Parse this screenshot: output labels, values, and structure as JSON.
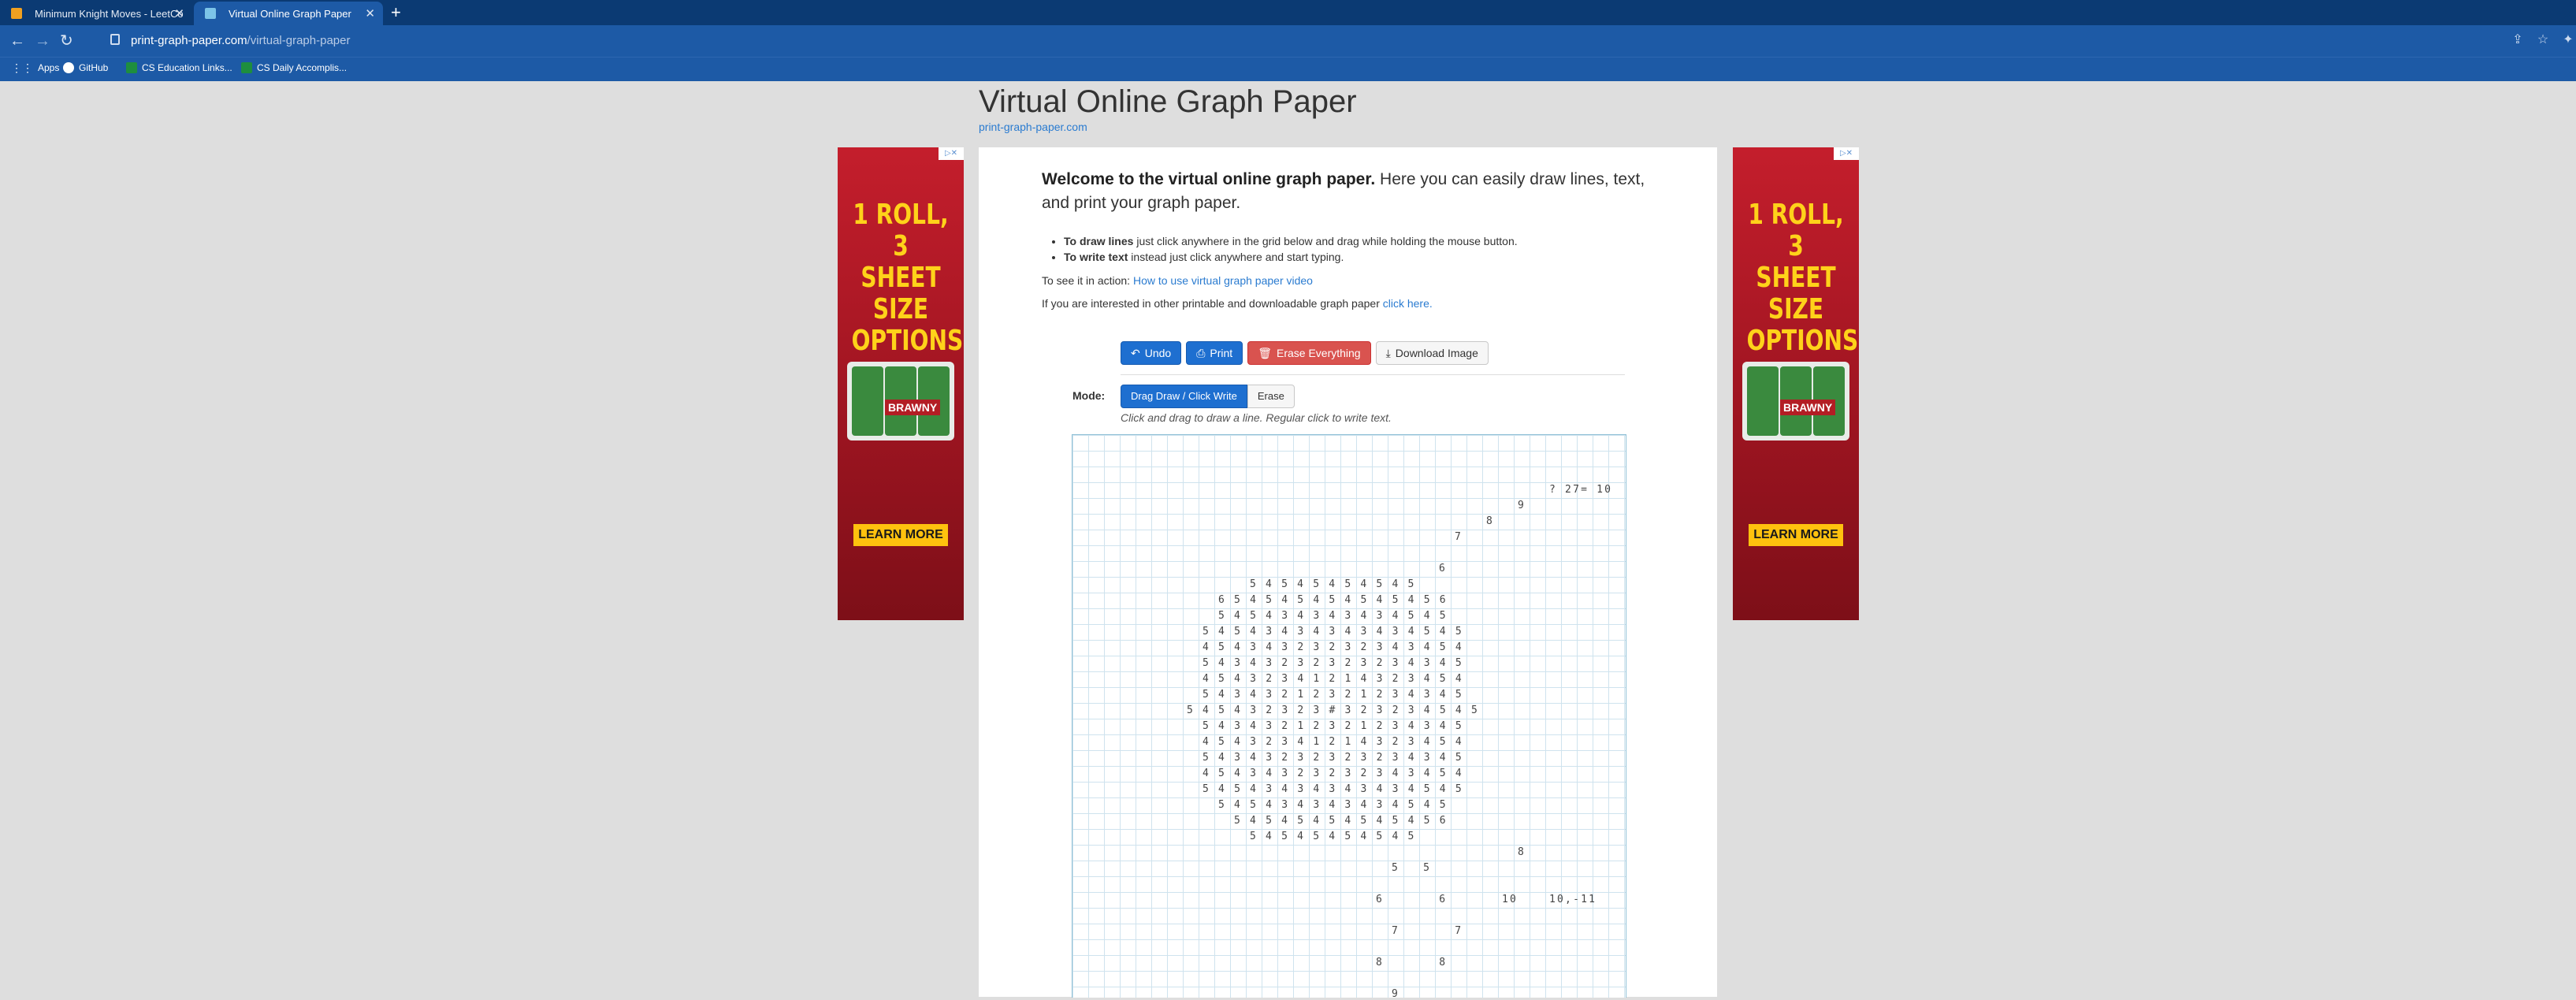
{
  "browser": {
    "tabs": [
      {
        "title": "Minimum Knight Moves - LeetCo",
        "active": false
      },
      {
        "title": "Virtual Online Graph Paper",
        "active": true
      }
    ],
    "url_host": "print-graph-paper.com",
    "url_path": "/virtual-graph-paper",
    "bookmarks": [
      "Apps",
      "GitHub",
      "CS Education Links...",
      "CS Daily Accomplis..."
    ]
  },
  "page": {
    "title": "Virtual Online Graph Paper",
    "subtitle": "print-graph-paper.com",
    "welcome_bold": "Welcome to the virtual online graph paper.",
    "welcome_rest": " Here you can easily draw lines, text, and print your graph paper.",
    "instructions": [
      {
        "bold": "To draw lines",
        "text": " just click anywhere in the grid below and drag while holding the mouse button."
      },
      {
        "bold": "To write text",
        "text": " instead just click anywhere and start typing."
      }
    ],
    "action_prefix": "To see it in action: ",
    "action_link": "How to use virtual graph paper video",
    "interest_prefix": "If you are interested in other printable and downloadable graph paper ",
    "interest_link": "click here."
  },
  "toolbar": {
    "undo": "Undo",
    "print": "Print",
    "erase_everything": "Erase Everything",
    "download_image": "Download Image"
  },
  "mode": {
    "label": "Mode:",
    "drag_draw": "Drag Draw / Click Write",
    "erase": "Erase",
    "hint": "Click and drag to draw a line. Regular click to write text."
  },
  "ads": {
    "headline": [
      "1 ROLL,",
      "3 SHEET",
      "SIZE",
      "OPTIONS"
    ],
    "brand": "BRAWNY",
    "cta": "LEARN MORE"
  },
  "grid_rows": [
    {
      "col": 30,
      "row": 3,
      "text": "? 27= 10"
    },
    {
      "col": 28,
      "row": 4,
      "text": "9"
    },
    {
      "col": 26,
      "row": 5,
      "text": "8"
    },
    {
      "col": 24,
      "row": 6,
      "text": "7"
    },
    {
      "col": 23,
      "row": 8,
      "text": "6"
    },
    {
      "col": 11,
      "row": 9,
      "text": "5 4 5 4 5 4 5 4 5 4 5"
    },
    {
      "col": 9,
      "row": 10,
      "text": "6 5 4 5 4 5 4 5 4 5 4 5 4 5 6"
    },
    {
      "col": 9,
      "row": 11,
      "text": "5 4 5 4 3 4 3 4 3 4 3 4 5 4 5"
    },
    {
      "col": 8,
      "row": 12,
      "text": "5 4 5 4 3 4 3 4 3 4 3 4 3 4 5 4 5"
    },
    {
      "col": 8,
      "row": 13,
      "text": "4 5 4 3 4 3 2 3 2 3 2 3 4 3 4 5 4"
    },
    {
      "col": 8,
      "row": 14,
      "text": "5 4 3 4 3 2 3 2 3 2 3 2 3 4 3 4 5"
    },
    {
      "col": 8,
      "row": 15,
      "text": "4 5 4 3 2 3 4 1 2 1 4 3 2 3 4 5 4"
    },
    {
      "col": 8,
      "row": 16,
      "text": "5 4 3 4 3 2 1 2 3 2 1 2 3 4 3 4 5"
    },
    {
      "col": 7,
      "row": 17,
      "text": "5 4 5 4 3 2 3 2 3 # 3 2 3 2 3 4 5 4 5"
    },
    {
      "col": 8,
      "row": 18,
      "text": "5 4 3 4 3 2 1 2 3 2 1 2 3 4 3 4 5"
    },
    {
      "col": 8,
      "row": 19,
      "text": "4 5 4 3 2 3 4 1 2 1 4 3 2 3 4 5 4"
    },
    {
      "col": 8,
      "row": 20,
      "text": "5 4 3 4 3 2 3 2 3 2 3 2 3 4 3 4 5"
    },
    {
      "col": 8,
      "row": 21,
      "text": "4 5 4 3 4 3 2 3 2 3 2 3 4 3 4 5 4"
    },
    {
      "col": 8,
      "row": 22,
      "text": "5 4 5 4 3 4 3 4 3 4 3 4 3 4 5 4 5"
    },
    {
      "col": 9,
      "row": 23,
      "text": "5 4 5 4 3 4 3 4 3 4 3 4 5 4 5"
    },
    {
      "col": 10,
      "row": 24,
      "text": "5 4 5 4 5 4 5 4 5 4 5 4 5 6"
    },
    {
      "col": 11,
      "row": 25,
      "text": "5 4 5 4 5 4 5 4 5 4 5"
    },
    {
      "col": 28,
      "row": 26,
      "text": "8"
    },
    {
      "col": 20,
      "row": 27,
      "text": "5   5"
    },
    {
      "col": 19,
      "row": 29,
      "text": "6       6"
    },
    {
      "col": 27,
      "row": 29,
      "text": "10"
    },
    {
      "col": 30,
      "row": 29,
      "text": "10,-11"
    },
    {
      "col": 20,
      "row": 31,
      "text": "7       7"
    },
    {
      "col": 19,
      "row": 33,
      "text": "8       8"
    },
    {
      "col": 20,
      "row": 35,
      "text": "9"
    }
  ]
}
